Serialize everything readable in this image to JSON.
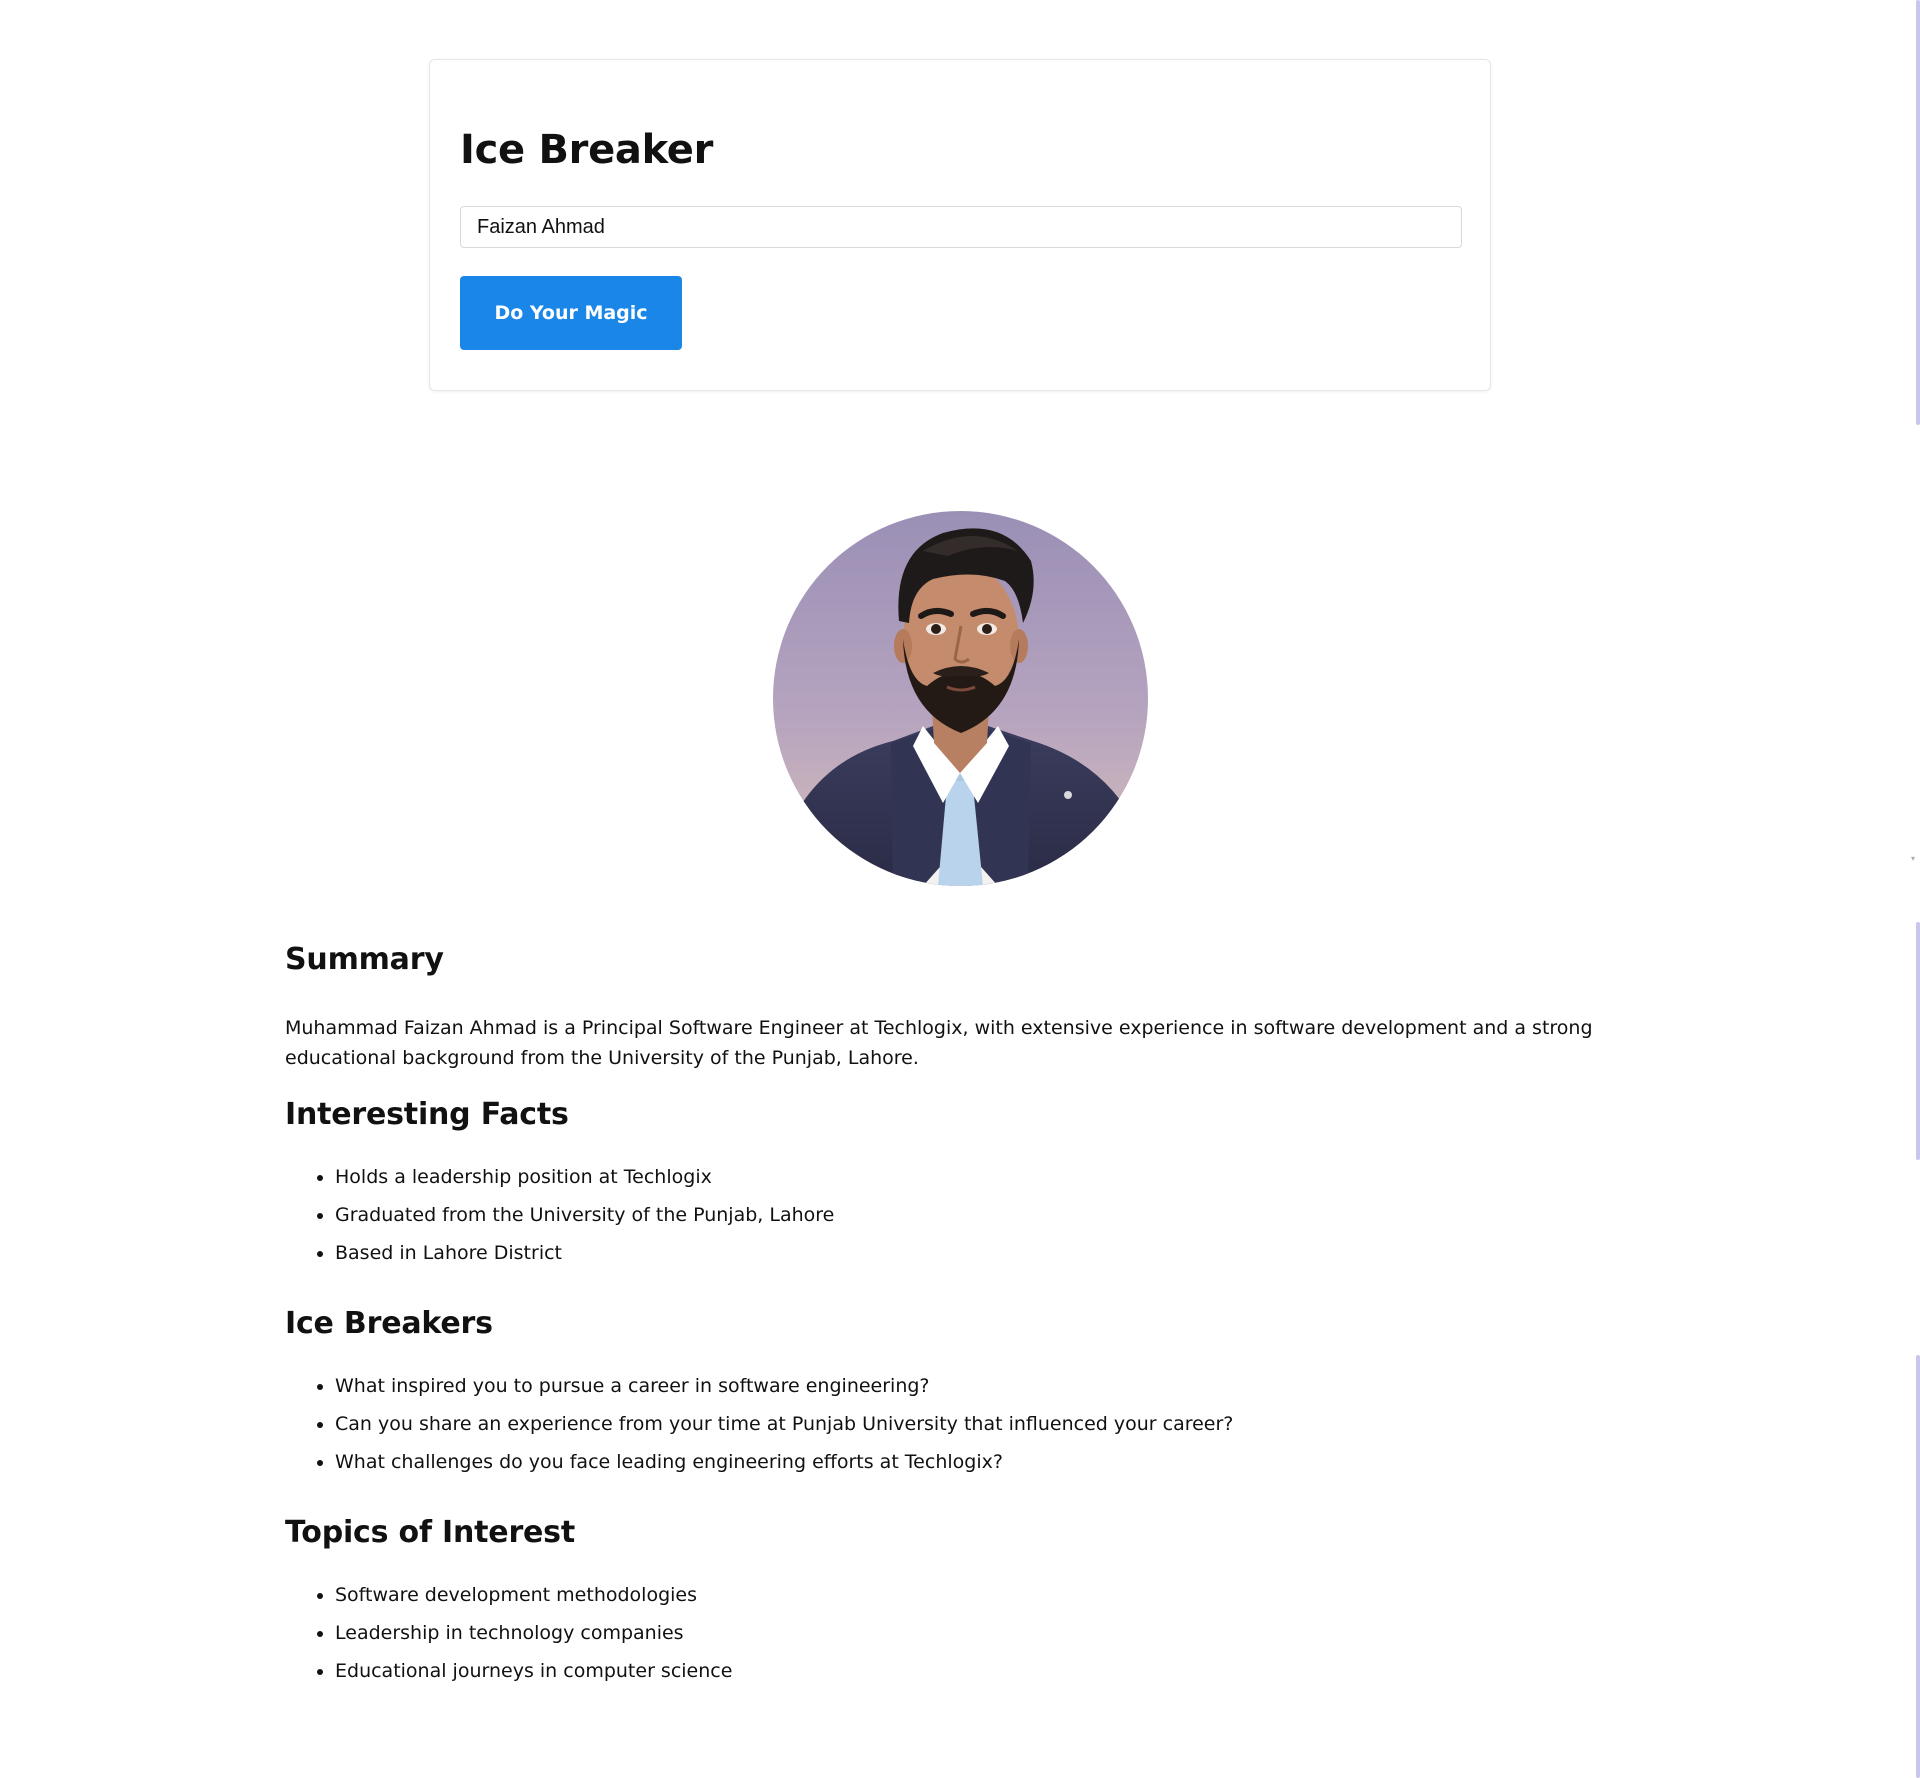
{
  "app": {
    "title": "Ice Breaker"
  },
  "form": {
    "name_value": "Faizan Ahmad",
    "button_label": "Do Your Magic",
    "accent_color": "#1a87e8"
  },
  "profile": {
    "summary_heading": "Summary",
    "summary_text": "Muhammad Faizan Ahmad is a Principal Software Engineer at Techlogix, with extensive experience in software development and a strong educational background from the University of the Punjab, Lahore.",
    "facts_heading": "Interesting Facts",
    "facts": [
      "Holds a leadership position at Techlogix",
      "Graduated from the University of the Punjab, Lahore",
      "Based in Lahore District"
    ],
    "ice_breakers_heading": "Ice Breakers",
    "ice_breakers": [
      "What inspired you to pursue a career in software engineering?",
      "Can you share an experience from your time at Punjab University that influenced your career?",
      "What challenges do you face leading engineering efforts at Techlogix?"
    ],
    "topics_heading": "Topics of Interest",
    "topics": [
      "Software development methodologies",
      "Leadership in technology companies",
      "Educational journeys in computer science"
    ]
  }
}
